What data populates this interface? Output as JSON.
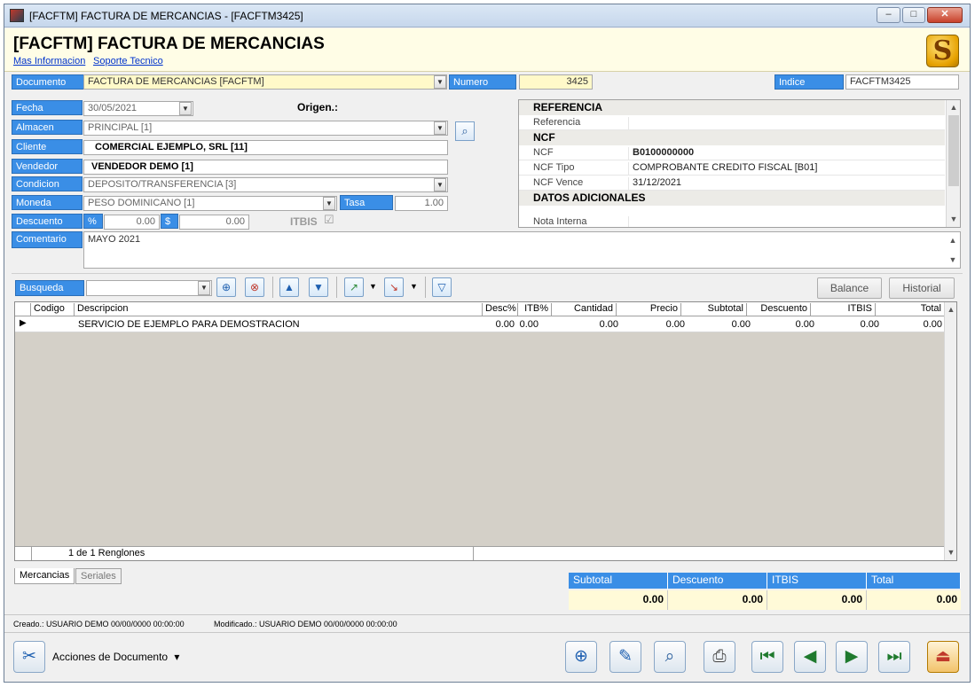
{
  "window": {
    "title": "[FACFTM] FACTURA DE MERCANCIAS - [FACFTM3425]",
    "minimize": "–",
    "restore": "□",
    "close": "✕"
  },
  "header": {
    "title": "[FACFTM] FACTURA DE MERCANCIAS",
    "link_info": "Mas Informacion",
    "link_support": "Soporte Tecnico",
    "logo_glyph": "S"
  },
  "doc": {
    "documento_label": "Documento",
    "documento_value": "FACTURA DE MERCANCIAS [FACFTM]",
    "numero_label": "Numero",
    "numero_value": "3425",
    "indice_label": "Indice",
    "indice_value": "FACFTM3425"
  },
  "form": {
    "fecha_label": "Fecha",
    "fecha_value": "30/05/2021",
    "origen_label": "Origen.:",
    "almacen_label": "Almacen",
    "almacen_value": "PRINCIPAL [1]",
    "cliente_label": "Cliente",
    "cliente_value": "COMERCIAL EJEMPLO, SRL [11]",
    "vendedor_label": "Vendedor",
    "vendedor_value": "VENDEDOR DEMO [1]",
    "condicion_label": "Condicion",
    "condicion_value": "DEPOSITO/TRANSFERENCIA [3]",
    "moneda_label": "Moneda",
    "moneda_value": "PESO DOMINICANO [1]",
    "tasa_label": "Tasa",
    "tasa_value": "1.00",
    "descuento_label": "Descuento",
    "pct_symbol": "%",
    "pct_value": "0.00",
    "amt_symbol": "$",
    "amt_value": "0.00",
    "itbis_label": "ITBIS",
    "itbis_check": "☑",
    "comentario_label": "Comentario",
    "comentario_value": "MAYO 2021"
  },
  "reference": {
    "sec_referencia": "REFERENCIA",
    "referencia_key": "Referencia",
    "referencia_value": "",
    "sec_ncf": "NCF",
    "ncf_key": "NCF",
    "ncf_value": "B0100000000",
    "ncf_tipo_key": "NCF Tipo",
    "ncf_tipo_value": "COMPROBANTE CREDITO FISCAL [B01]",
    "ncf_vence_key": "NCF Vence",
    "ncf_vence_value": "31/12/2021",
    "sec_datos": "DATOS ADICIONALES",
    "nota_key": "Nota Interna"
  },
  "toolbar": {
    "busqueda_label": "Busqueda",
    "busqueda_value": "",
    "balance": "Balance",
    "historial": "Historial"
  },
  "grid": {
    "columns": [
      "Codigo",
      "Descripcion",
      "Desc%",
      "ITB%",
      "Cantidad",
      "Precio",
      "Subtotal",
      "Descuento",
      "ITBIS",
      "Total"
    ],
    "row": {
      "codigo": "",
      "descripcion": "SERVICIO DE EJEMPLO PARA DEMOSTRACION",
      "desc_pct": "0.00",
      "itb_pct": "0.00",
      "cantidad": "0.00",
      "precio": "0.00",
      "subtotal": "0.00",
      "descuento": "0.00",
      "itbis": "0.00",
      "total": "0.00"
    },
    "footer_count": "1  de 1 Renglones"
  },
  "tabs": {
    "mercancias": "Mercancias",
    "seriales": "Seriales"
  },
  "totals": {
    "subtotal_label": "Subtotal",
    "subtotal_value": "0.00",
    "descuento_label": "Descuento",
    "descuento_value": "0.00",
    "itbis_label": "ITBIS",
    "itbis_value": "0.00",
    "total_label": "Total",
    "total_value": "0.00"
  },
  "status": {
    "creado": "Creado.: USUARIO DEMO 00/00/0000 00:00:00",
    "modificado": "Modificado.: USUARIO DEMO 00/00/0000 00:00:00"
  },
  "actions": {
    "label": "Acciones de Documento",
    "caret": "▾"
  },
  "colors": {
    "label_blue": "#3a8ee6",
    "header_yellow": "#fffde6",
    "grid_gray": "#d4d0c8"
  }
}
